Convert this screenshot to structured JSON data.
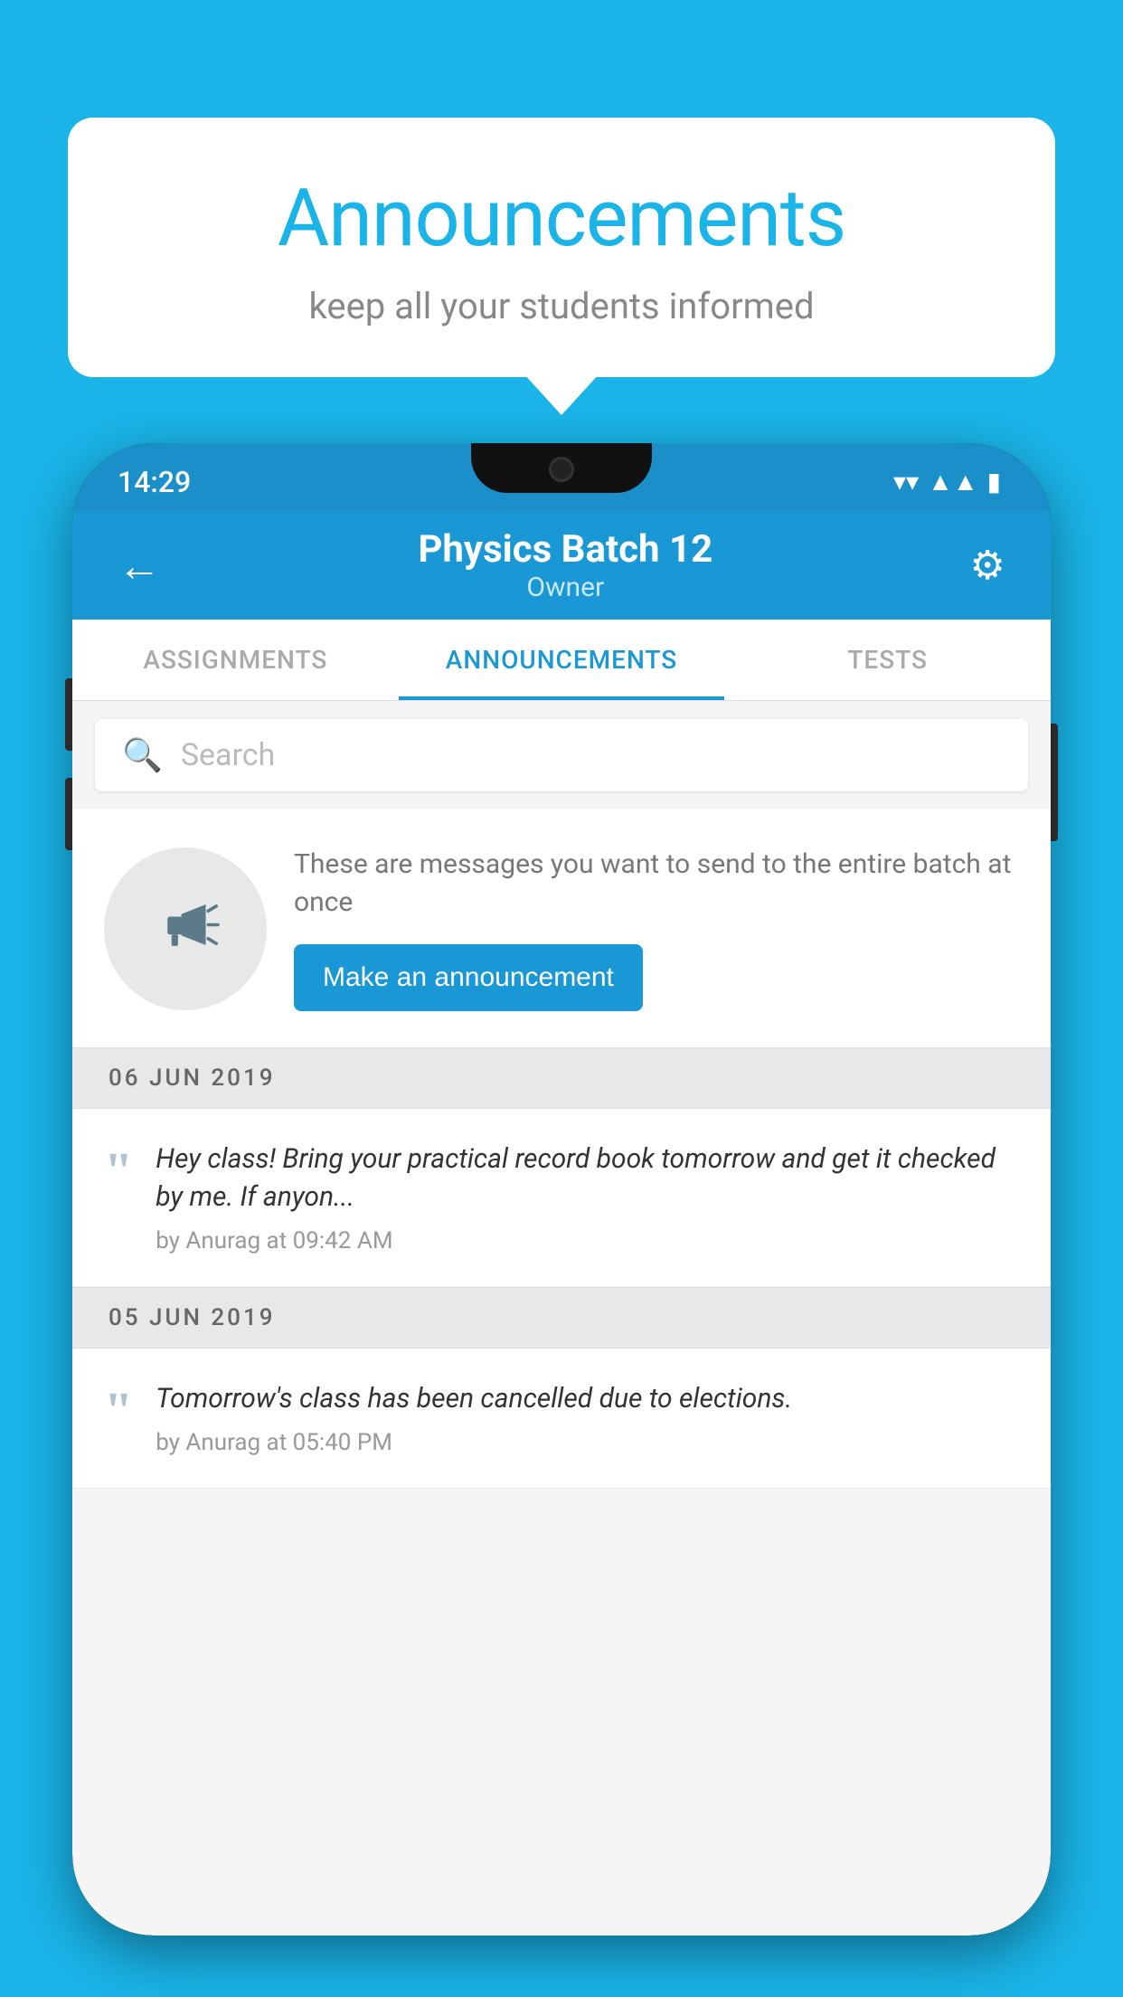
{
  "background_color": "#1ab4e8",
  "speech_bubble": {
    "title": "Announcements",
    "subtitle": "keep all your students informed"
  },
  "status_bar": {
    "time": "14:29",
    "wifi": "▼",
    "signal": "▲",
    "battery": "▮"
  },
  "app_bar": {
    "title": "Physics Batch 12",
    "subtitle": "Owner",
    "back_label": "←",
    "settings_label": "⚙"
  },
  "tabs": [
    {
      "label": "ASSIGNMENTS",
      "active": false
    },
    {
      "label": "ANNOUNCEMENTS",
      "active": true
    },
    {
      "label": "TESTS",
      "active": false
    },
    {
      "label": "...",
      "active": false
    }
  ],
  "search": {
    "placeholder": "Search"
  },
  "announcement_prompt": {
    "description": "These are messages you want to send to the entire batch at once",
    "button_label": "Make an announcement"
  },
  "announcements": [
    {
      "date": "06  JUN  2019",
      "items": [
        {
          "message": "Hey class! Bring your practical record book tomorrow and get it checked by me. If anyon...",
          "meta": "by Anurag at 09:42 AM"
        }
      ]
    },
    {
      "date": "05  JUN  2019",
      "items": [
        {
          "message": "Tomorrow's class has been cancelled due to elections.",
          "meta": "by Anurag at 05:40 PM"
        }
      ]
    }
  ]
}
